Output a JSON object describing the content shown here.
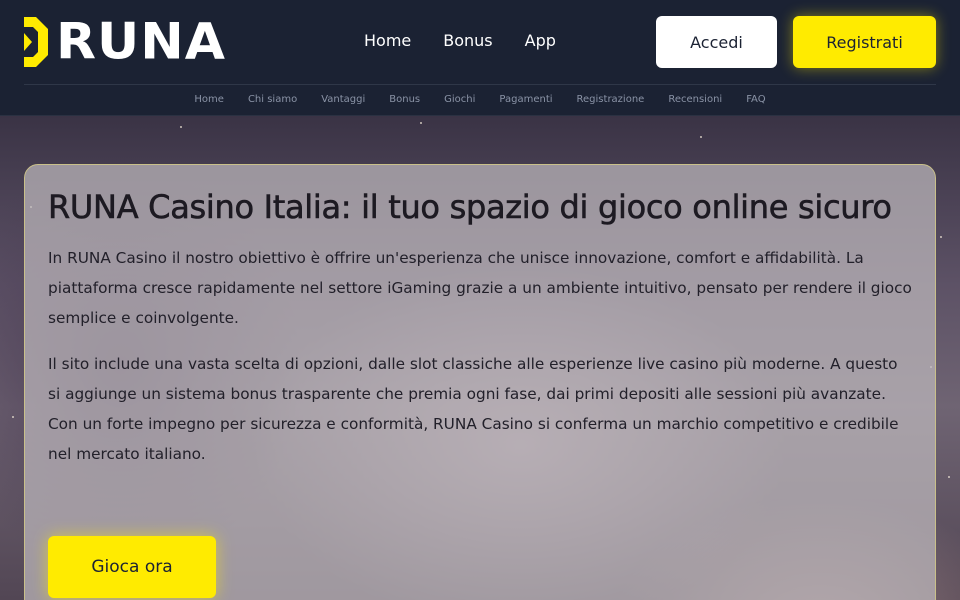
{
  "brand": {
    "name": "RUNA",
    "accent": "#ffeb00"
  },
  "main_nav": [
    {
      "label": "Home"
    },
    {
      "label": "Bonus"
    },
    {
      "label": "App"
    }
  ],
  "auth": {
    "login_label": "Accedi",
    "register_label": "Registrati"
  },
  "sub_nav": [
    {
      "label": "Home"
    },
    {
      "label": "Chi siamo"
    },
    {
      "label": "Vantaggi"
    },
    {
      "label": "Bonus"
    },
    {
      "label": "Giochi"
    },
    {
      "label": "Pagamenti"
    },
    {
      "label": "Registrazione"
    },
    {
      "label": "Recensioni"
    },
    {
      "label": "FAQ"
    }
  ],
  "hero": {
    "title": "RUNA Casino Italia: il tuo spazio di gioco online sicuro",
    "paragraphs": [
      "In RUNA Casino il nostro obiettivo è offrire un'esperienza che unisce innovazione, comfort e affidabilità. La piattaforma cresce rapidamente nel settore iGaming grazie a un ambiente intuitivo, pensato per rendere il gioco semplice e coinvolgente.",
      "Il sito include una vasta scelta di opzioni, dalle slot classiche alle esperienze live casino più moderne. A questo si aggiunge un sistema bonus trasparente che premia ogni fase, dai primi depositi alle sessioni più avanzate. Con un forte impegno per sicurezza e conformità, RUNA Casino si conferma un marchio competitivo e credibile nel mercato italiano."
    ],
    "cta_label": "Gioca ora"
  }
}
